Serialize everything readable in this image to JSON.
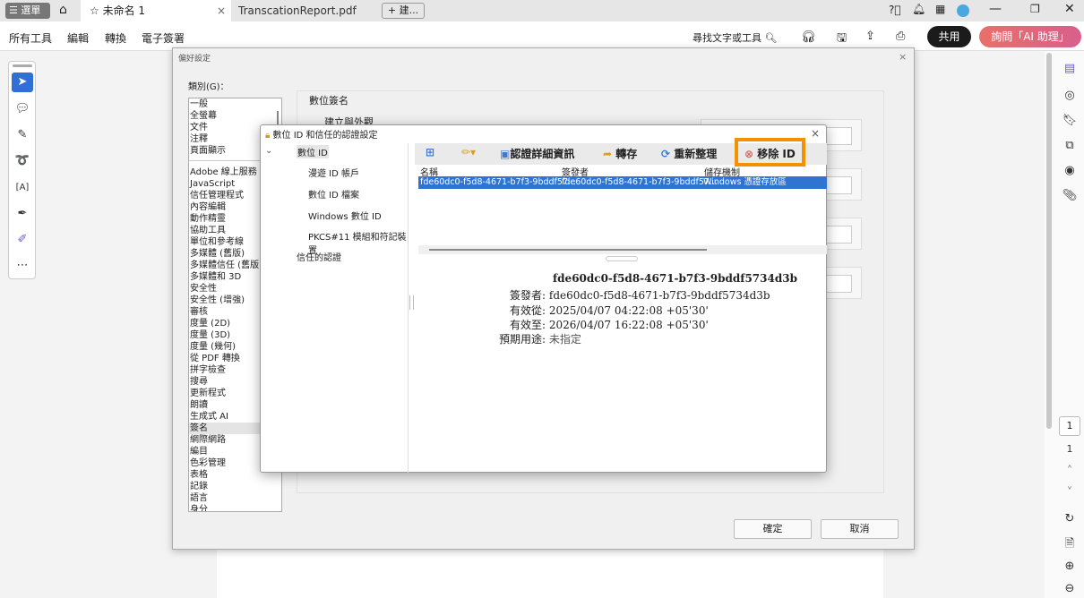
{
  "tabbar": {
    "menu": "☰ 選單",
    "tab1": "未命名 1",
    "tab2": "TranscationReport.pdf",
    "new_tab": "+ 建..."
  },
  "menubar": {
    "items": [
      "所有工具",
      "編輯",
      "轉換",
      "電子簽署"
    ],
    "search": "尋找文字或工具",
    "share": "共用",
    "ai": "詢問「AI 助理」"
  },
  "rightbar": {
    "page_input": "1",
    "page_total": "1"
  },
  "prefs": {
    "title": "偏好設定",
    "category_label": "類別(G)：",
    "categories_top": [
      "一般",
      "全螢幕",
      "文件",
      "注釋",
      "頁面顯示"
    ],
    "categories": [
      "Adobe 線上服務",
      "JavaScript",
      "信任管理程式",
      "內容編輯",
      "動作精靈",
      "協助工具",
      "單位和參考線",
      "多媒體 (舊版)",
      "多媒體信任 (舊版)",
      "多媒體和 3D",
      "安全性",
      "安全性 (增強)",
      "審核",
      "度量 (2D)",
      "度量 (3D)",
      "度量 (幾何)",
      "從 PDF 轉換",
      "拼字檢查",
      "搜尋",
      "更新程式",
      "朗讀",
      "生成式 AI",
      "簽名",
      "網際網路",
      "編目",
      "色彩管理",
      "表格",
      "記錄",
      "語言",
      "身分"
    ],
    "section": "數位簽名",
    "subsection": "建立與外觀",
    "ok": "確定",
    "cancel": "取消"
  },
  "id_dialog": {
    "title": "數位 ID 和信任的認證設定",
    "tree": [
      "數位 ID",
      "漫遊 ID 帳戶",
      "數位 ID 檔案",
      "Windows 數位 ID",
      "PKCS#11 模組和符記裝置",
      "信任的認證"
    ],
    "toolbar": {
      "details": "認證詳細資訊",
      "export": "轉存",
      "refresh": "重新整理",
      "remove": "移除 ID"
    },
    "columns": [
      "名稱",
      "簽發者",
      "儲存機制"
    ],
    "rows": [
      [
        "fde60dc0-f5d8-4671-b7f3-9bddf57...",
        "fde60dc0-f5d8-4671-b7f3-9bddf57...",
        "Windows 憑證存放區"
      ]
    ],
    "detail": {
      "name": "fde60dc0-f5d8-4671-b7f3-9bddf5734d3b",
      "issuer_label": "簽發者:",
      "issuer": "fde60dc0-f5d8-4671-b7f3-9bddf5734d3b",
      "from_label": "有效從:",
      "from": "2025/04/07 04:22:08 +05'30'",
      "to_label": "有效至:",
      "to": "2026/04/07 16:22:08 +05'30'",
      "usage_label": "預期用途:",
      "usage": "未指定"
    }
  }
}
